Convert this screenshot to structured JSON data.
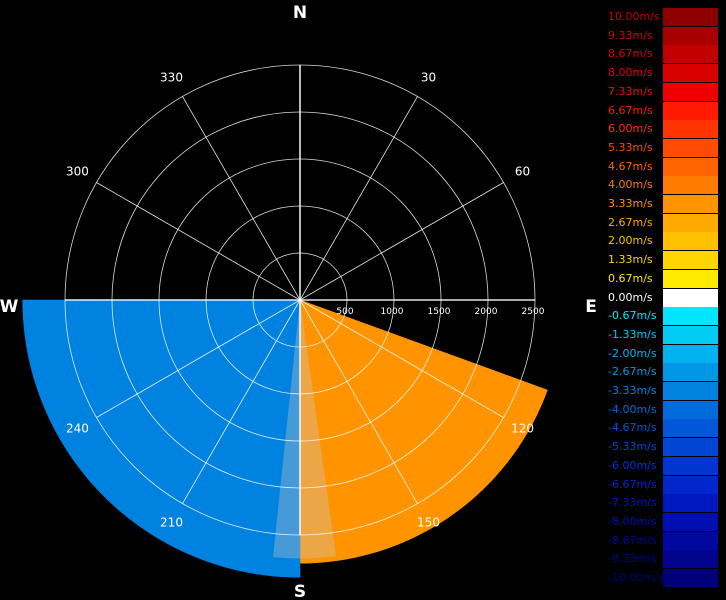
{
  "chart_data": {
    "type": "polar-sector",
    "cardinals": {
      "north": "N",
      "east": "E",
      "south": "S",
      "west": "W"
    },
    "azimuth_labels": [
      {
        "deg": 30,
        "text": "30"
      },
      {
        "deg": 60,
        "text": "60"
      },
      {
        "deg": 120,
        "text": "120"
      },
      {
        "deg": 150,
        "text": "150"
      },
      {
        "deg": 210,
        "text": "210"
      },
      {
        "deg": 240,
        "text": "240"
      },
      {
        "deg": 300,
        "text": "300"
      },
      {
        "deg": 330,
        "text": "330"
      }
    ],
    "range_labels": [
      {
        "value": 500,
        "text": "500"
      },
      {
        "value": 1000,
        "text": "1000"
      },
      {
        "value": 1500,
        "text": "1500"
      },
      {
        "value": 2000,
        "text": "2000"
      },
      {
        "value": 2500,
        "text": "2500"
      }
    ],
    "max_range": 2500,
    "ring_count": 5,
    "spoke_step_deg": 30,
    "sector": {
      "start_deg": 90,
      "end_deg": 270,
      "east_edge_deg": 110,
      "north_west_edge_deg": 270
    },
    "velocity_profile": [
      {
        "az_from": 90,
        "az_to": 110,
        "velocity_ms": 4.3
      },
      {
        "az_from": 110,
        "az_to": 180,
        "velocity_ms": 3.2
      },
      {
        "az_from": 180,
        "az_to": 270,
        "velocity_ms": -3.3
      }
    ],
    "legend": [
      {
        "text": "10.00m/s",
        "color": "#8e0000",
        "text_color": "#c00000"
      },
      {
        "text": "9.33m/s",
        "color": "#a80000",
        "text_color": "#d00000"
      },
      {
        "text": "8.67m/s",
        "color": "#c20000",
        "text_color": "#dd0000"
      },
      {
        "text": "8.00m/s",
        "color": "#d90000",
        "text_color": "#e60000"
      },
      {
        "text": "7.33m/s",
        "color": "#ee0000",
        "text_color": "#ee0c0c"
      },
      {
        "text": "6.67m/s",
        "color": "#ff1a00",
        "text_color": "#ff1a00"
      },
      {
        "text": "6.00m/s",
        "color": "#ff3400",
        "text_color": "#ff3400"
      },
      {
        "text": "5.33m/s",
        "color": "#ff4c00",
        "text_color": "#ff4c00"
      },
      {
        "text": "4.67m/s",
        "color": "#ff6400",
        "text_color": "#ff6400"
      },
      {
        "text": "4.00m/s",
        "color": "#ff7c00",
        "text_color": "#ff7c00"
      },
      {
        "text": "3.33m/s",
        "color": "#ff9400",
        "text_color": "#ff9400"
      },
      {
        "text": "2.67m/s",
        "color": "#ffaa00",
        "text_color": "#ffaa00"
      },
      {
        "text": "2.00m/s",
        "color": "#ffc000",
        "text_color": "#ffc000"
      },
      {
        "text": "1.33m/s",
        "color": "#ffd500",
        "text_color": "#ffd500"
      },
      {
        "text": "0.67m/s",
        "color": "#ffea00",
        "text_color": "#ffea00"
      },
      {
        "text": "0.00m/s",
        "color": "#ffffff",
        "text_color": "#ffffff"
      },
      {
        "text": "-0.67m/s",
        "color": "#00e6ff",
        "text_color": "#00e6ff"
      },
      {
        "text": "-1.33m/s",
        "color": "#00ccf5",
        "text_color": "#00ccf5"
      },
      {
        "text": "-2.00m/s",
        "color": "#00b2ee",
        "text_color": "#00b2ee"
      },
      {
        "text": "-2.67m/s",
        "color": "#0098e6",
        "text_color": "#0098e6"
      },
      {
        "text": "-3.33m/s",
        "color": "#0082e0",
        "text_color": "#0082e0"
      },
      {
        "text": "-4.00m/s",
        "color": "#006cdc",
        "text_color": "#006cdc"
      },
      {
        "text": "-4.67m/s",
        "color": "#0058d8",
        "text_color": "#0058d8"
      },
      {
        "text": "-5.33m/s",
        "color": "#0046d4",
        "text_color": "#0046d4"
      },
      {
        "text": "-6.00m/s",
        "color": "#0036d0",
        "text_color": "#0036d0"
      },
      {
        "text": "-6.67m/s",
        "color": "#0026cc",
        "text_color": "#0026cc"
      },
      {
        "text": "-7.33m/s",
        "color": "#0018c0",
        "text_color": "#0018c0"
      },
      {
        "text": "-8.00m/s",
        "color": "#000eb2",
        "text_color": "#000eb2"
      },
      {
        "text": "-8.67m/s",
        "color": "#0008a0",
        "text_color": "#0008a0"
      },
      {
        "text": "-9.33m/s",
        "color": "#00038c",
        "text_color": "#00038c"
      },
      {
        "text": "-10.00m/s",
        "color": "#000078",
        "text_color": "#000078"
      }
    ]
  }
}
